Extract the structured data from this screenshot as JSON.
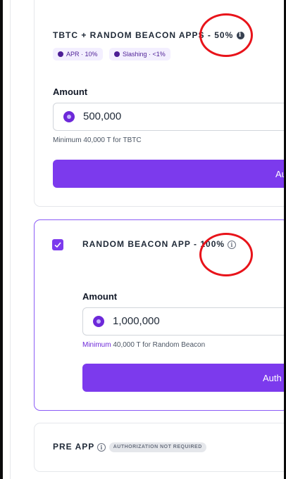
{
  "cards": [
    {
      "title": "TBTC + RANDOM BEACON APPS - 50%",
      "badges": [
        "APR · 10%",
        "Slashing · <1%"
      ],
      "amount_label": "Amount",
      "amount_value": "500,000",
      "helper": "Minimum 40,000 T for TBTC",
      "button_label": "Au"
    },
    {
      "title": "RANDOM BEACON APP - 100%",
      "checked": true,
      "amount_label": "Amount",
      "amount_value": "1,000,000",
      "helper_highlight": "Minimum",
      "helper_rest": "40,000 T for Random Beacon",
      "button_label": "Auth"
    },
    {
      "title": "PRE APP",
      "pill": "AUTHORIZATION NOT REQUIRED"
    }
  ],
  "colors": {
    "accent": "#7c3aed",
    "annotation": "#e8131a"
  }
}
